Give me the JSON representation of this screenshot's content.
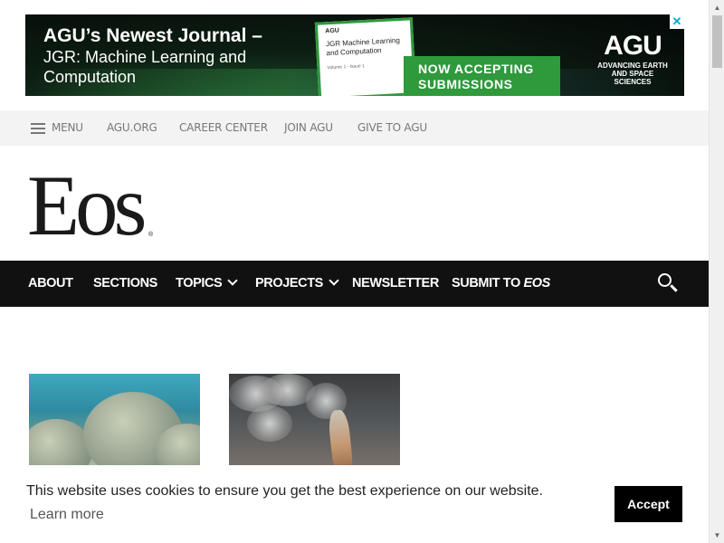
{
  "ad": {
    "title": "AGU’s Newest Journal –",
    "subtitle": "JGR: Machine Learning and Computation",
    "cover_logo": "AGU",
    "cover_title": "JGR Machine Learning and Computation",
    "cover_volume": "Volume 1 · Issue 1",
    "cta": "NOW ACCEPTING SUBMISSIONS",
    "brand": "AGU",
    "brand_tagline": "ADVANCING EARTH AND SPACE SCIENCES",
    "close": "✕"
  },
  "utility_nav": {
    "menu_label": "MENU",
    "items": [
      "AGU.ORG",
      "CAREER CENTER",
      "JOIN AGU",
      "GIVE TO AGU"
    ]
  },
  "logo": {
    "text": "Eos",
    "registered": "®"
  },
  "main_nav": {
    "about": "ABOUT",
    "sections": "SECTIONS",
    "topics": "TOPICS",
    "projects": "PROJECTS",
    "newsletter": "NEWSLETTER",
    "submit_prefix": "SUBMIT TO ",
    "submit_emph": "EOS"
  },
  "cookie": {
    "message": "This website uses cookies to ensure you get the best experience on our website.",
    "learn_more": "Learn more",
    "accept": "Accept"
  },
  "scrollbar": {
    "up": "▲",
    "down": "▼"
  },
  "colors": {
    "nav_bg": "#111111",
    "utility_bg": "#f3f3f3",
    "ad_green": "#2e9a3c",
    "close_x": "#00aecd"
  },
  "icons": {
    "menu": "hamburger-icon",
    "search": "search-icon",
    "dropdown": "chevron-down-icon"
  }
}
